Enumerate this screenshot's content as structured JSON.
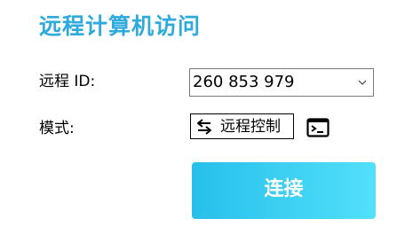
{
  "title": "远程计算机访问",
  "form": {
    "id_label": "远程 ID:",
    "id_value": "260 853 979",
    "mode_label": "模式:",
    "mode_value": "远程控制"
  },
  "icons": {
    "id_dropdown": "chevron-down-icon",
    "mode_switch": "swap-arrows-icon",
    "terminal": "terminal-icon"
  },
  "connect_label": "连接",
  "colors": {
    "title": "#2eaadc",
    "button_gradient_start": "#27bfe9",
    "button_gradient_end": "#52e0fb"
  }
}
